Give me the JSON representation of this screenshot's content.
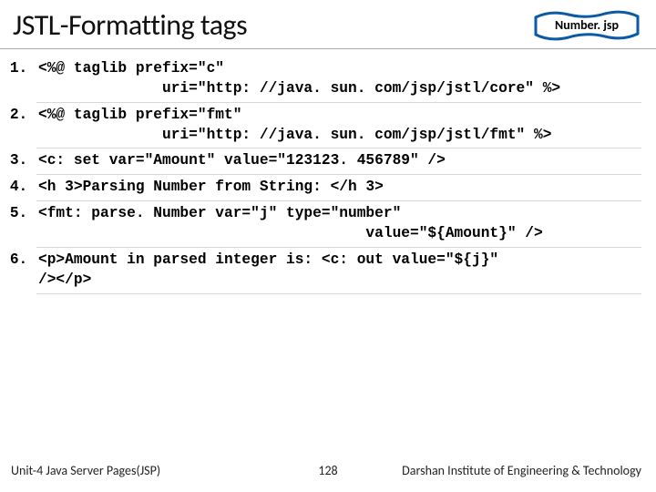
{
  "header": {
    "title": "JSTL-Formatting tags",
    "file_badge": "Number. jsp"
  },
  "code": {
    "lines": [
      "<%@ taglib prefix=\"c\"\n              uri=\"http: //java. sun. com/jsp/jstl/core\" %>",
      "<%@ taglib prefix=\"fmt\"\n              uri=\"http: //java. sun. com/jsp/jstl/fmt\" %>",
      "<c: set var=\"Amount\" value=\"123123. 456789\" />",
      "<h 3>Parsing Number from String: </h 3>",
      "<fmt: parse. Number var=\"j\" type=\"number\"\n                                     value=\"${Amount}\" />",
      "<p>Amount in parsed integer is: <c: out value=\"${j}\"\n/></p>"
    ]
  },
  "footer": {
    "left": "Unit-4 Java Server Pages(JSP)",
    "center": "128",
    "right": "Darshan Institute of Engineering & Technology"
  }
}
